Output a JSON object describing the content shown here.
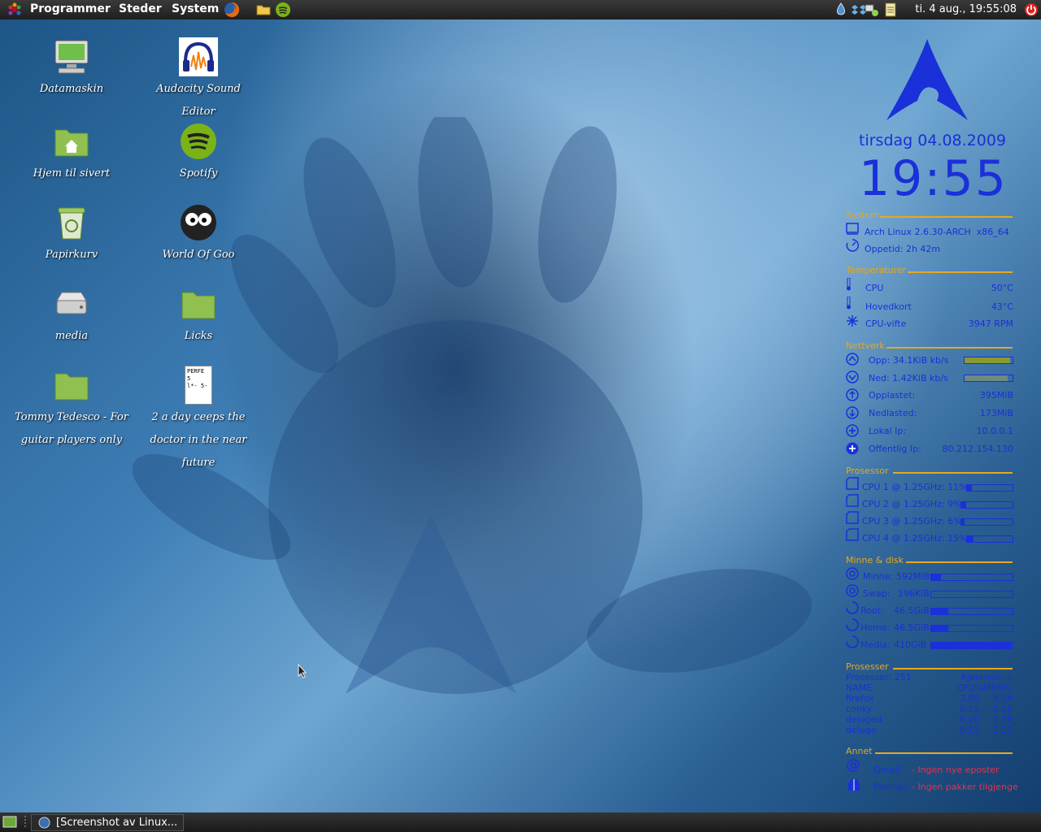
{
  "top_panel": {
    "menus": [
      "Programmer",
      "Steder",
      "System"
    ],
    "clock": "ti. 4 aug., 19:55:08"
  },
  "desktop_icons": [
    {
      "label": "Datamaskin",
      "icon": "computer-icon"
    },
    {
      "label": "Audacity Sound Editor",
      "icon": "audacity-icon"
    },
    {
      "label": "Hjem til sivert",
      "icon": "home-folder-icon"
    },
    {
      "label": "Spotify",
      "icon": "spotify-icon"
    },
    {
      "label": "Papirkurv",
      "icon": "trash-icon"
    },
    {
      "label": "World Of Goo",
      "icon": "world-of-goo-icon"
    },
    {
      "label": "media",
      "icon": "drive-icon"
    },
    {
      "label": "Licks",
      "icon": "folder-icon"
    },
    {
      "label": "Tommy Tedesco - For guitar players only",
      "icon": "folder-icon"
    },
    {
      "label": "2 a day ceeps the doctor in the near future",
      "icon": "document-icon",
      "doc_text": "PERFE\n5\nl*- 5-"
    }
  ],
  "taskbar": {
    "task_label": "[Screenshot av Linux..."
  },
  "conky": {
    "date": "tirsdag 04.08.2009",
    "time": "19:55",
    "system": {
      "title": "System",
      "kernel": "Arch Linux 2.6.30-ARCH  x86_64",
      "uptime": "Oppetid: 2h 42m"
    },
    "temperatures": {
      "title": "Temperaturer",
      "rows": [
        {
          "label": "CPU",
          "value": "50°C"
        },
        {
          "label": "Hovedkort",
          "value": "43°C"
        },
        {
          "label": "CPU-vifte",
          "value": "3947 RPM"
        }
      ]
    },
    "network": {
      "title": "Nettverk",
      "up": "Opp: 34.1KiB kb/s",
      "down": "Ned: 1.42KiB kb/s",
      "up_level": 0.95,
      "down_level": 0.9,
      "rows": [
        {
          "label": "Opplastet:",
          "value": "395MiB"
        },
        {
          "label": "Nedlasted:",
          "value": "173MiB"
        },
        {
          "label": "Lokal Ip:",
          "value": "10.0.0.1"
        },
        {
          "label": "Offentlig Ip:",
          "value": "80.212.154.130"
        }
      ]
    },
    "processor": {
      "title": "Prosessor",
      "cpus": [
        {
          "label": "CPU 1 @ 1.25GHz: 11%",
          "level": 0.11
        },
        {
          "label": "CPU 2 @ 1.25GHz: 9%",
          "level": 0.09
        },
        {
          "label": "CPU 3 @ 1.25GHz: 6%",
          "level": 0.06
        },
        {
          "label": "CPU 4 @ 1.25GHz: 15%",
          "level": 0.15
        }
      ]
    },
    "memory": {
      "title": "Minne & disk",
      "rows": [
        {
          "label": "Minne:",
          "value": "592MiB",
          "level": 0.12
        },
        {
          "label": "Swap:",
          "value": "196KiB",
          "level": 0.0
        },
        {
          "label": "Root:",
          "value": "46.5GiB",
          "level": 0.21
        },
        {
          "label": "Home:",
          "value": "46.5GiB",
          "level": 0.21
        },
        {
          "label": "Media:",
          "value": "410GiB",
          "level": 0.98
        }
      ]
    },
    "processes": {
      "title": "Prosesser",
      "count": "Prosesser: 251",
      "running": "Kjørende: 1",
      "header": {
        "name": "NAME",
        "cpu": "CPU%",
        "mem": "MEM%"
      },
      "rows": [
        {
          "name": "firefox",
          "cpu": "3.00",
          "mem": "4.14"
        },
        {
          "name": "conky",
          "cpu": "0.25",
          "mem": "0.16"
        },
        {
          "name": "deluged",
          "cpu": "0.25",
          "mem": "1.76"
        },
        {
          "name": "deluge",
          "cpu": "0.25",
          "mem": "1.30"
        }
      ]
    },
    "other": {
      "title": "Annet",
      "gmail_label": "Gmail",
      "gmail_value": "- Ingen nye eposter",
      "pacman_label": "Pacman",
      "pacman_value": "- Ingen pakker tilgjenge"
    },
    "colors": {
      "text": "#1a30d8",
      "section": "#e6a820",
      "alert": "#e8304a"
    }
  }
}
